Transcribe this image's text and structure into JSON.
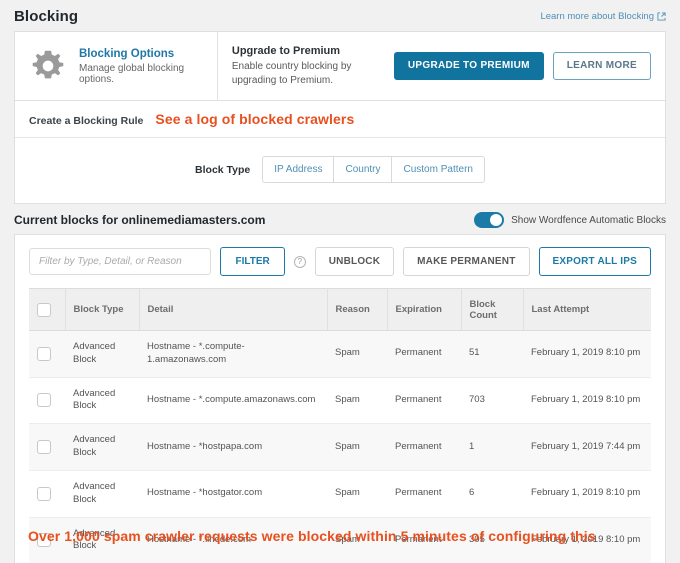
{
  "header": {
    "title": "Blocking",
    "learn_more_link": "Learn more about Blocking",
    "external_link_icon": "external-link-icon"
  },
  "options_strip": {
    "gear_icon": "gear-icon",
    "blocking_options_title": "Blocking Options",
    "blocking_options_sub": "Manage global blocking options.",
    "upgrade_title": "Upgrade to Premium",
    "upgrade_sub": "Enable country blocking by upgrading to Premium.",
    "upgrade_button": "UPGRADE TO PREMIUM",
    "learn_more_button": "LEARN MORE"
  },
  "rule_section": {
    "label": "Create a Blocking Rule",
    "annotation": "See a log of blocked crawlers",
    "block_type_label": "Block Type",
    "block_type_options": [
      "IP Address",
      "Country",
      "Custom Pattern"
    ]
  },
  "current_blocks": {
    "title": "Current blocks for onlinemediamasters.com",
    "toggle_label": "Show Wordfence Automatic Blocks",
    "toggle_on": true
  },
  "toolbar": {
    "filter_placeholder": "Filter by Type, Detail, or Reason",
    "filter_value": "",
    "filter_button": "FILTER",
    "help_icon": "?",
    "unblock_button": "UNBLOCK",
    "make_permanent_button": "MAKE PERMANENT",
    "export_button": "EXPORT ALL IPS"
  },
  "table": {
    "columns": [
      "",
      "Block Type",
      "Detail",
      "Reason",
      "Expiration",
      "Block Count",
      "Last Attempt"
    ],
    "rows": [
      {
        "block_type": "Advanced Block",
        "detail": "Hostname - *.compute-1.amazonaws.com",
        "reason": "Spam",
        "expiration": "Permanent",
        "block_count": "51",
        "last_attempt": "February 1, 2019 8:10 pm"
      },
      {
        "block_type": "Advanced Block",
        "detail": "Hostname - *.compute.amazonaws.com",
        "reason": "Spam",
        "expiration": "Permanent",
        "block_count": "703",
        "last_attempt": "February 1, 2019 8:10 pm"
      },
      {
        "block_type": "Advanced Block",
        "detail": "Hostname - *hostpapa.com",
        "reason": "Spam",
        "expiration": "Permanent",
        "block_count": "1",
        "last_attempt": "February 1, 2019 7:44 pm"
      },
      {
        "block_type": "Advanced Block",
        "detail": "Hostname - *hostgator.com",
        "reason": "Spam",
        "expiration": "Permanent",
        "block_count": "6",
        "last_attempt": "February 1, 2019 8:10 pm"
      },
      {
        "block_type": "Advanced Block",
        "detail": "Hostname - *.linode.com",
        "reason": "Spam",
        "expiration": "Permanent",
        "block_count": "305",
        "last_attempt": "February 1, 2019 8:10 pm"
      }
    ]
  },
  "annotations": {
    "bottom": "Over 1,000 spam crawler requests were blocked within 5 minutes of configuring this",
    "color": "#e8501f"
  },
  "colors": {
    "accent_blue": "#11749e",
    "link_blue": "#4f90b5",
    "annotation_orange": "#e8501f",
    "page_background": "#f1f1f1"
  }
}
